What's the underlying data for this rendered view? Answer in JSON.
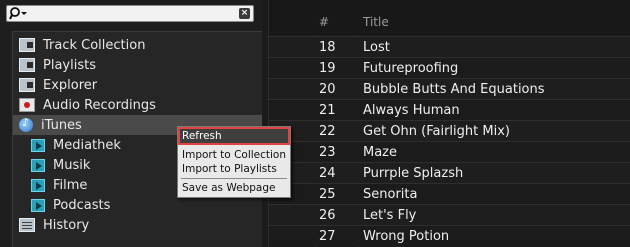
{
  "search": {
    "placeholder": ""
  },
  "sidebar": {
    "items": [
      {
        "label": "Track Collection",
        "icon": "track-collection-icon"
      },
      {
        "label": "Playlists",
        "icon": "playlists-folder-icon"
      },
      {
        "label": "Explorer",
        "icon": "explorer-folder-icon"
      },
      {
        "label": "Audio Recordings",
        "icon": "audio-recordings-icon"
      },
      {
        "label": "iTunes",
        "icon": "itunes-icon"
      },
      {
        "label": "Mediathek",
        "icon": "play-icon"
      },
      {
        "label": "Musik",
        "icon": "play-icon"
      },
      {
        "label": "Filme",
        "icon": "play-icon"
      },
      {
        "label": "Podcasts",
        "icon": "play-icon"
      },
      {
        "label": "History",
        "icon": "history-icon"
      }
    ]
  },
  "context_menu": {
    "items": [
      "Refresh",
      "Import to Collection",
      "Import to Playlists",
      "Save as Webpage"
    ],
    "highlighted": "Refresh",
    "highlight_color": "#e0443c"
  },
  "tracklist": {
    "columns": {
      "number": "#",
      "title": "Title"
    },
    "rows": [
      {
        "num": "18",
        "title": "Lost"
      },
      {
        "num": "19",
        "title": "Futureproofing"
      },
      {
        "num": "20",
        "title": "Bubble Butts And Equations"
      },
      {
        "num": "21",
        "title": "Always Human"
      },
      {
        "num": "22",
        "title": "Get Ohn (Fairlight Mix)"
      },
      {
        "num": "23",
        "title": "Maze"
      },
      {
        "num": "24",
        "title": "Purrple Splazsh"
      },
      {
        "num": "25",
        "title": "Senorita"
      },
      {
        "num": "26",
        "title": "Let's Fly"
      },
      {
        "num": "27",
        "title": "Wrong Potion"
      }
    ]
  }
}
